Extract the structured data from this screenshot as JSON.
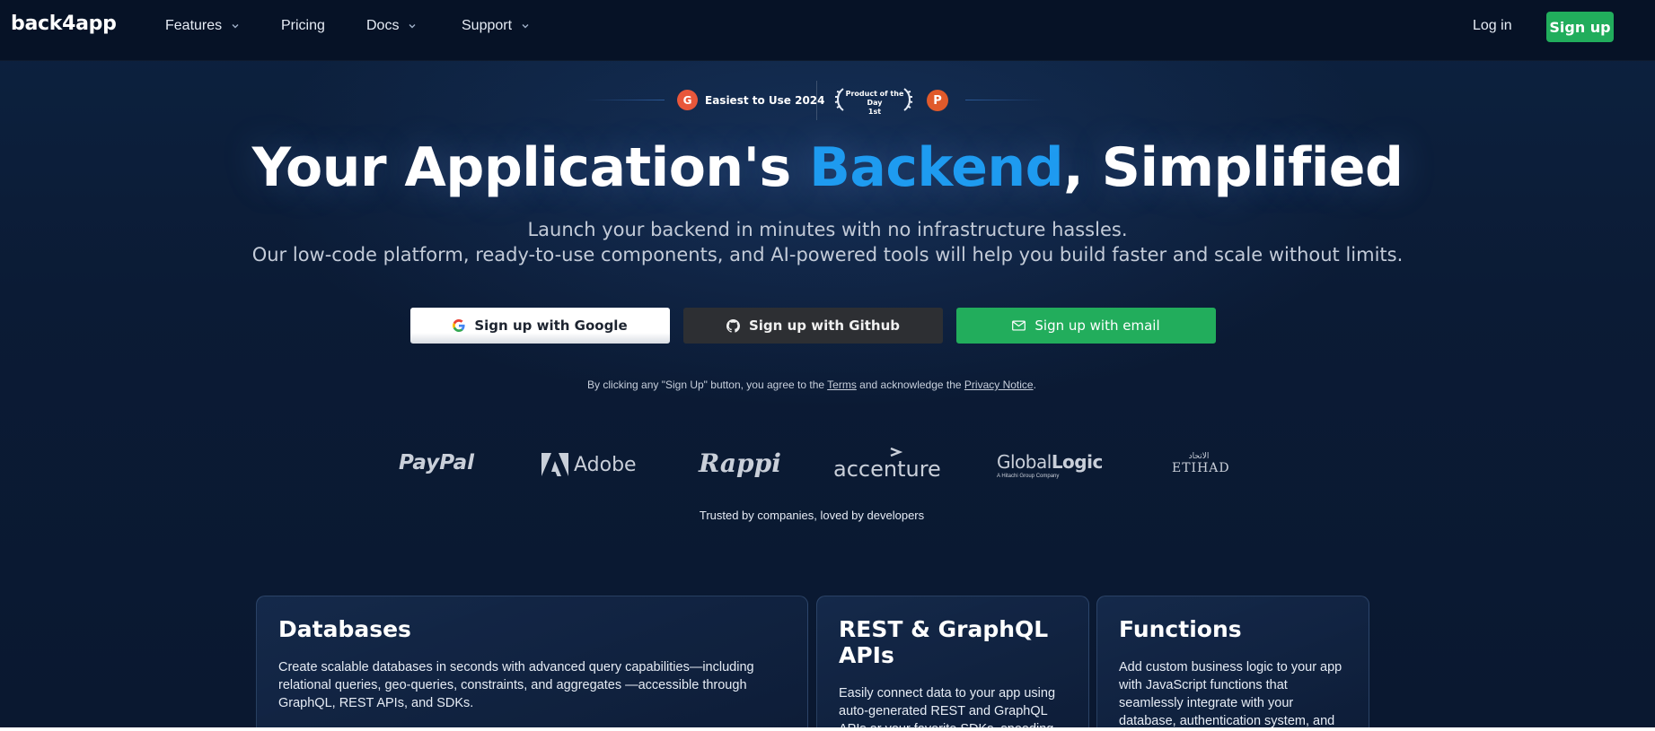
{
  "nav": {
    "logo": "back4app",
    "items": [
      {
        "label": "Features",
        "has_dropdown": true
      },
      {
        "label": "Pricing",
        "has_dropdown": false
      },
      {
        "label": "Docs",
        "has_dropdown": true
      },
      {
        "label": "Support",
        "has_dropdown": true
      }
    ],
    "login_label": "Log in",
    "signup_label": "Sign up"
  },
  "awards": {
    "g2_letter": "G",
    "award1": "Easiest to Use 2024",
    "award2_line1": "Product of the Day",
    "award2_line2": "1st",
    "ph_letter": "P"
  },
  "hero": {
    "title_prefix": "Your Application's ",
    "title_accent": "Backend",
    "title_suffix": ", Simplified",
    "subtitle_line1": "Launch your backend in minutes with no infrastructure hassles.",
    "subtitle_line2": "Our low-code platform, ready-to-use components, and AI-powered tools will help you build faster and scale without limits."
  },
  "signup": {
    "google": "Sign up with Google",
    "github": "Sign up with Github",
    "email": "Sign up with email"
  },
  "terms": {
    "prefix": "By clicking any \"Sign Up\" button, you agree to the ",
    "terms_link": "Terms",
    "middle": " and acknowledge the ",
    "privacy_link": "Privacy Notice",
    "suffix": "."
  },
  "logos": {
    "paypal": "PayPal",
    "adobe": "Adobe",
    "rappi": "Rappi",
    "accenture": "accenture",
    "globallogic_a": "Global",
    "globallogic_b": "Logic",
    "globallogic_sub": "A Hitachi Group Company",
    "etihad": "ETIHAD",
    "etihad_ar": "الاتحاد",
    "trusted": "Trusted by companies, loved by developers"
  },
  "cards": [
    {
      "title": "Databases",
      "desc": "Create scalable databases in seconds with advanced query capabilities—including relational queries, geo-queries, constraints, and aggregates —accessible through GraphQL, REST APIs, and SDKs."
    },
    {
      "title": "REST & GraphQL APIs",
      "desc": "Easily connect data to your app using auto-generated REST and GraphQL APIs or your favorite SDKs, speeding up development time and reducing"
    },
    {
      "title": "Functions",
      "desc": "Add custom business logic to your app with JavaScript functions that seamlessly integrate with your database, authentication system, and"
    }
  ],
  "colors": {
    "accent_blue": "#1e9bf0",
    "brand_green": "#21ad5c",
    "nav_bg": "#061226",
    "page_bg": "#0b1a33"
  }
}
